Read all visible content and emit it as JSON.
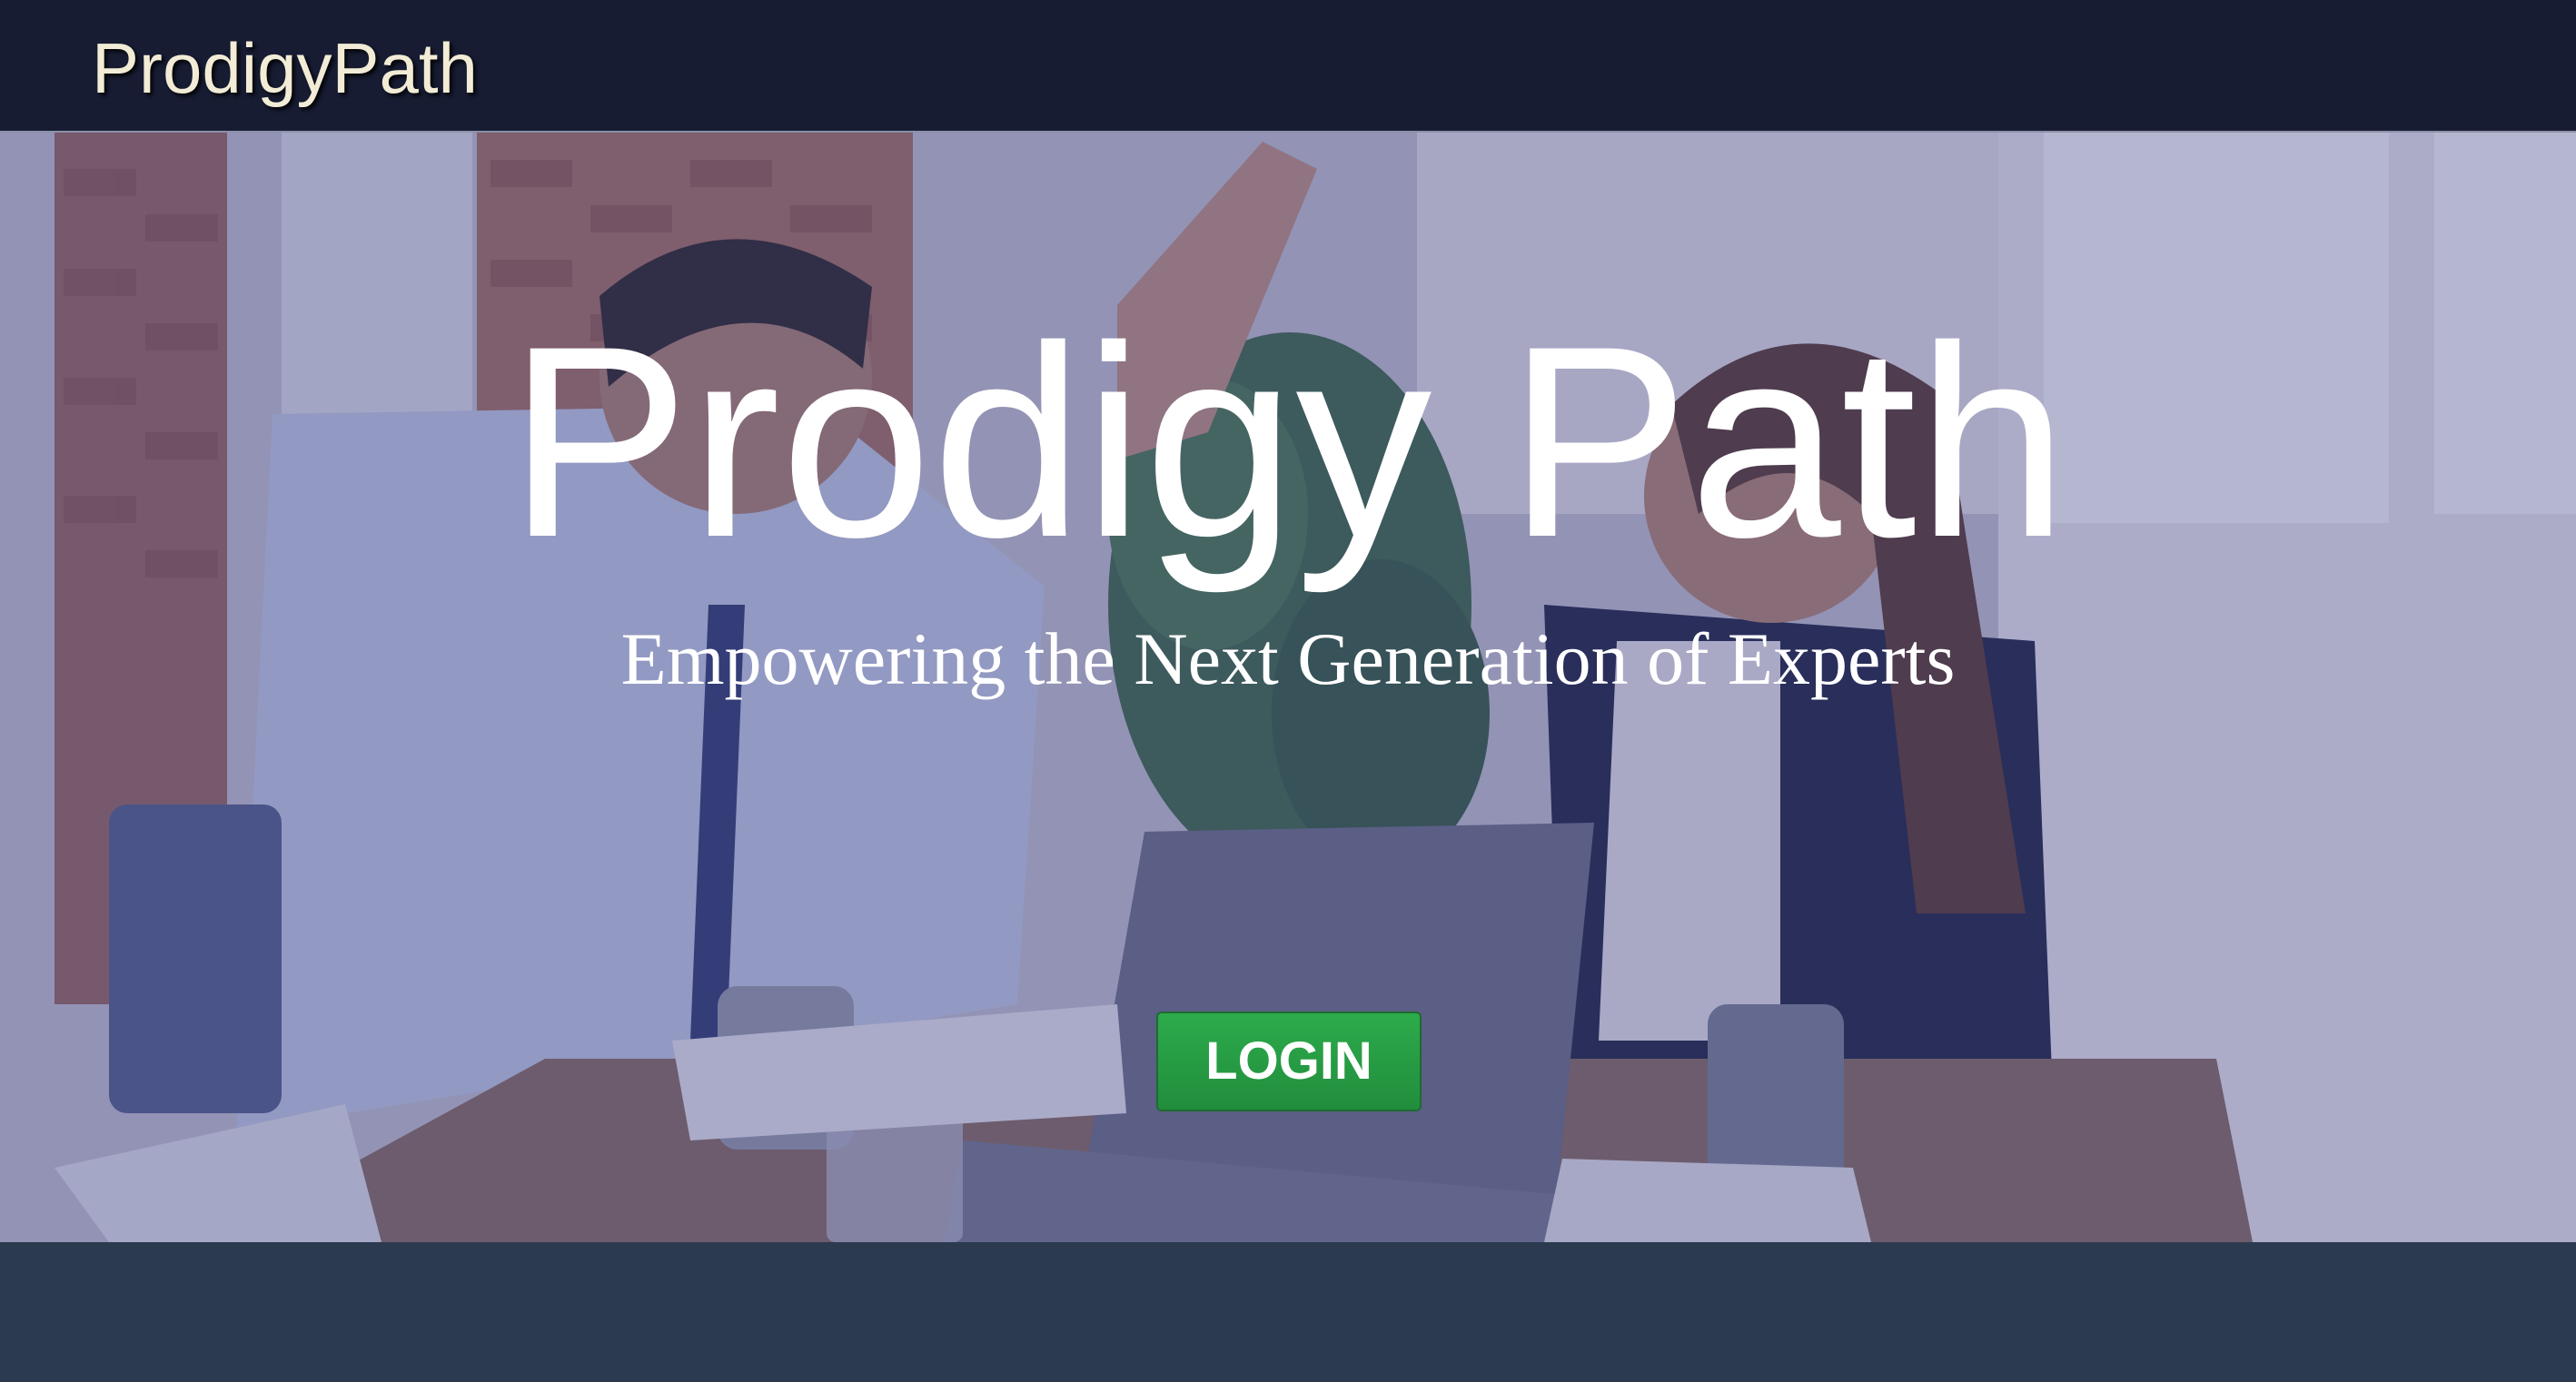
{
  "navbar": {
    "brand": "ProdigyPath"
  },
  "hero": {
    "title": "Prodigy Path",
    "subtitle": "Empowering the Next Generation of Experts",
    "login_label": "LOGIN"
  },
  "colors": {
    "navbar_bg": "#171c33",
    "brand_text": "#f2ecd6",
    "hero_overlay": "#3c3e82",
    "login_button": "#28a745",
    "footer_bg": "#2b3a4e"
  }
}
